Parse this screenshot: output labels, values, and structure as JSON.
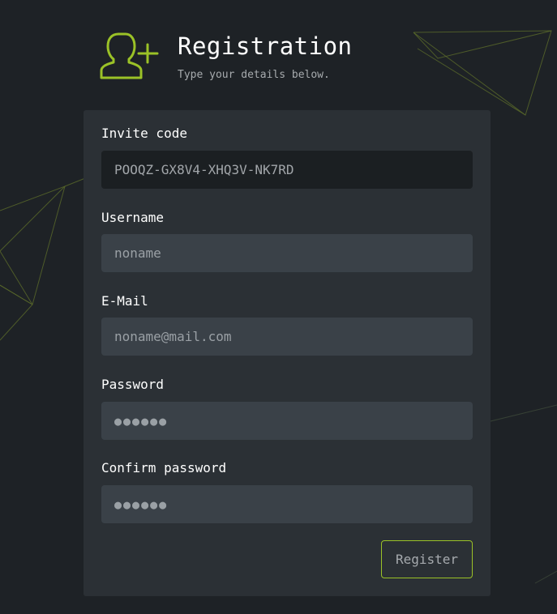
{
  "header": {
    "title": "Registration",
    "subtitle": "Type your details below.",
    "icon": "add-user-icon"
  },
  "form": {
    "invite_code": {
      "label": "Invite code",
      "value": "POOQZ-GX8V4-XHQ3V-NK7RD"
    },
    "username": {
      "label": "Username",
      "placeholder": "noname"
    },
    "email": {
      "label": "E-Mail",
      "placeholder": "noname@mail.com"
    },
    "password": {
      "label": "Password",
      "placeholder": "●●●●●●"
    },
    "confirm_password": {
      "label": "Confirm password",
      "placeholder": "●●●●●●"
    },
    "submit_label": "Register"
  },
  "colors": {
    "background": "#1e2226",
    "card": "#2b3035",
    "input": "#3a4148",
    "input_readonly": "#1b1f22",
    "accent": "#9bc227"
  }
}
